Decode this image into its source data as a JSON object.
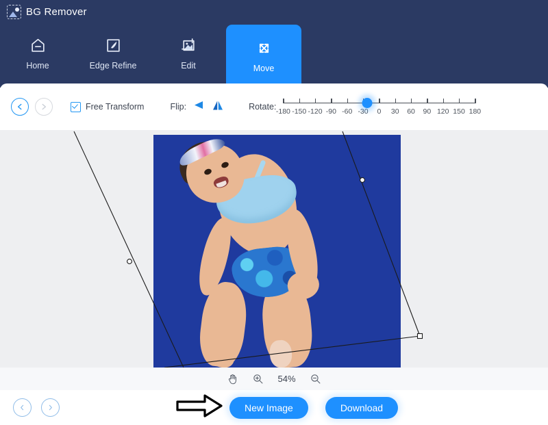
{
  "app": {
    "title": "BG Remover",
    "logo_icon": "image-placeholder-icon"
  },
  "nav": {
    "items": [
      {
        "label": "Home",
        "icon": "home-icon",
        "active": false
      },
      {
        "label": "Edge Refine",
        "icon": "brush-square-icon",
        "active": false
      },
      {
        "label": "Edit",
        "icon": "image-edit-icon",
        "active": false
      },
      {
        "label": "Move",
        "icon": "move-arrows-icon",
        "active": true
      }
    ]
  },
  "toolbar": {
    "undo_icon": "undo-arrow-icon",
    "redo_icon": "redo-arrow-icon",
    "free_transform_label": "Free Transform",
    "free_transform_checked": true,
    "flip_label": "Flip:",
    "flip_horizontal_icon": "flip-horizontal-icon",
    "flip_vertical_icon": "flip-vertical-icon",
    "rotate_label": "Rotate:",
    "rotate_value": -22,
    "rotate_min": -180,
    "rotate_max": 180,
    "rotate_ticks": [
      "-180",
      "-150",
      "-120",
      "-90",
      "-60",
      "-30",
      "0",
      "30",
      "60",
      "90",
      "120",
      "150",
      "180"
    ]
  },
  "canvas": {
    "background_color": "#eeeff1",
    "image_background_color": "#1f3a9e",
    "transform_handle_icon": "transform-handle-icon"
  },
  "zoombar": {
    "hand_icon": "hand-tool-icon",
    "zoom_in_icon": "zoom-in-icon",
    "zoom_out_icon": "zoom-out-icon",
    "zoom_level": "54%"
  },
  "bottombar": {
    "prev_icon": "chevron-left-icon",
    "next_icon": "chevron-right-icon",
    "pointer_icon": "arrow-right-annotation",
    "new_image_label": "New Image",
    "download_label": "Download"
  },
  "colors": {
    "header_bg": "#2b3a63",
    "accent": "#1e90ff",
    "canvas_bg": "#eeeff1",
    "photo_bg": "#1f3a9e"
  }
}
